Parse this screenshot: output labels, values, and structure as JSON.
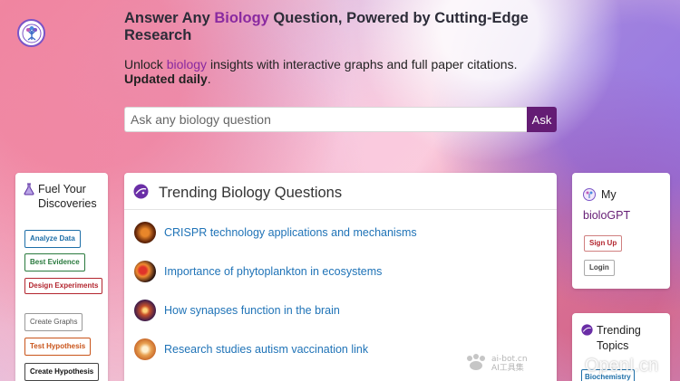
{
  "logo": {
    "icon": "tree-of-life-icon"
  },
  "hero": {
    "title_pre": "Answer Any ",
    "title_accent": "Biology",
    "title_post": " Question, Powered by Cutting-Edge Research",
    "subtitle_pre": "Unlock ",
    "subtitle_accent": "biology",
    "subtitle_post": " insights with interactive graphs and full paper citations.",
    "subtitle_bold": "Updated daily",
    "subtitle_end": "."
  },
  "search": {
    "placeholder": "Ask any biology question",
    "value": "",
    "button_label": "Ask"
  },
  "left_panel": {
    "heading": "Fuel Your Discoveries",
    "icon": "flask-icon",
    "tags": [
      {
        "label": "Analyze Data",
        "color": "#1e6fa8"
      },
      {
        "label": "Best Evidence",
        "color": "#2a7a3e"
      },
      {
        "label": "Design Experiments",
        "color": "#b3262f"
      },
      {
        "label": "Create Graphs",
        "color": "#555555"
      },
      {
        "label": "Test Hypothesis",
        "color": "#c9541a"
      },
      {
        "label": "Create Hypothesis",
        "color": "#111111"
      }
    ]
  },
  "trending": {
    "heading": "Trending Biology Questions",
    "icon": "planet-icon",
    "questions": [
      {
        "label": "CRISPR technology applications and mechanisms",
        "thumb": "dna-thumbnail"
      },
      {
        "label": "Importance of phytoplankton in ecosystems",
        "thumb": "plankton-thumbnail"
      },
      {
        "label": "How synapses function in the brain",
        "thumb": "neuron-thumbnail"
      },
      {
        "label": "Research studies autism vaccination link",
        "thumb": "vaccine-thumbnail"
      }
    ]
  },
  "account": {
    "heading_pre": "My",
    "heading_accent": "bioloGPT",
    "icon": "tree-of-life-icon",
    "signup_label": "Sign Up",
    "login_label": "Login"
  },
  "topics": {
    "heading": "Trending Topics",
    "icon": "planet-icon",
    "first_topic": "Biochemistry"
  },
  "watermarks": {
    "ai_bot": "ai-bot.cn",
    "ai_tool": "AI工具集",
    "openi": "OpenI.cn"
  },
  "colors": {
    "accent": "#8a2aa0",
    "ask_button": "#641c74",
    "link": "#1f73b7"
  }
}
